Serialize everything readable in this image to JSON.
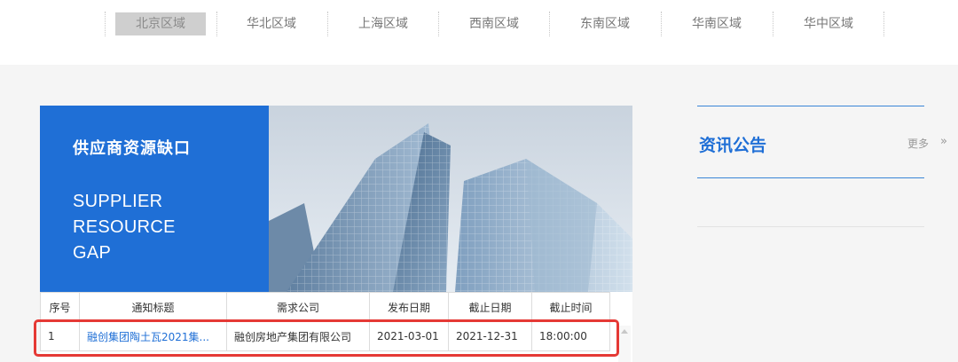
{
  "regions": [
    {
      "label": "北京区域",
      "active": true
    },
    {
      "label": "华北区域"
    },
    {
      "label": "上海区域"
    },
    {
      "label": "西南区域"
    },
    {
      "label": "东南区域"
    },
    {
      "label": "华南区域"
    },
    {
      "label": "华中区域"
    }
  ],
  "banner": {
    "title": "供应商资源缺口",
    "en_line1": "SUPPLIER",
    "en_line2": "RESOURCE",
    "en_line3": "GAP"
  },
  "table": {
    "headers": [
      "序号",
      "通知标题",
      "需求公司",
      "发布日期",
      "截止日期",
      "截止时间"
    ],
    "rows": [
      [
        "1",
        "融创集团陶土瓦2021集...",
        "融创房地产集团有限公司",
        "2021-03-01",
        "2021-12-31",
        "18:00:00"
      ]
    ]
  },
  "news": {
    "title": "资讯公告",
    "more": "更多",
    "more_arrow": "»"
  },
  "colors": {
    "accent": "#1f6fd6",
    "highlight": "#e53935"
  }
}
